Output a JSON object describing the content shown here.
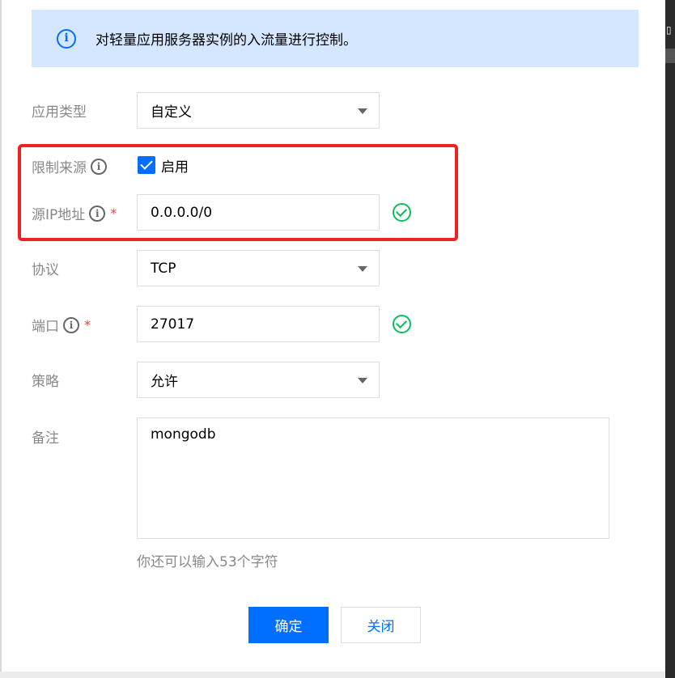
{
  "notice": {
    "icon": "info-circle-icon",
    "text": "对轻量应用服务器实例的入流量进行控制。"
  },
  "form": {
    "app_type": {
      "label": "应用类型",
      "value": "自定义"
    },
    "restrict_source": {
      "label": "限制来源",
      "checkbox_label": "启用",
      "checked": true
    },
    "source_ip": {
      "label": "源IP地址",
      "required_mark": "*",
      "value": "0.0.0.0/0",
      "valid": true
    },
    "protocol": {
      "label": "协议",
      "value": "TCP"
    },
    "port": {
      "label": "端口",
      "required_mark": "*",
      "value": "27017",
      "valid": true
    },
    "policy": {
      "label": "策略",
      "value": "允许"
    },
    "remark": {
      "label": "备注",
      "value": "mongodb",
      "hint": "你还可以输入53个字符"
    }
  },
  "buttons": {
    "confirm": "确定",
    "close": "关闭"
  },
  "colors": {
    "primary": "#006eff",
    "success": "#0abf5b",
    "highlight": "#ee2222",
    "notice_bg": "#d5e7ff"
  }
}
